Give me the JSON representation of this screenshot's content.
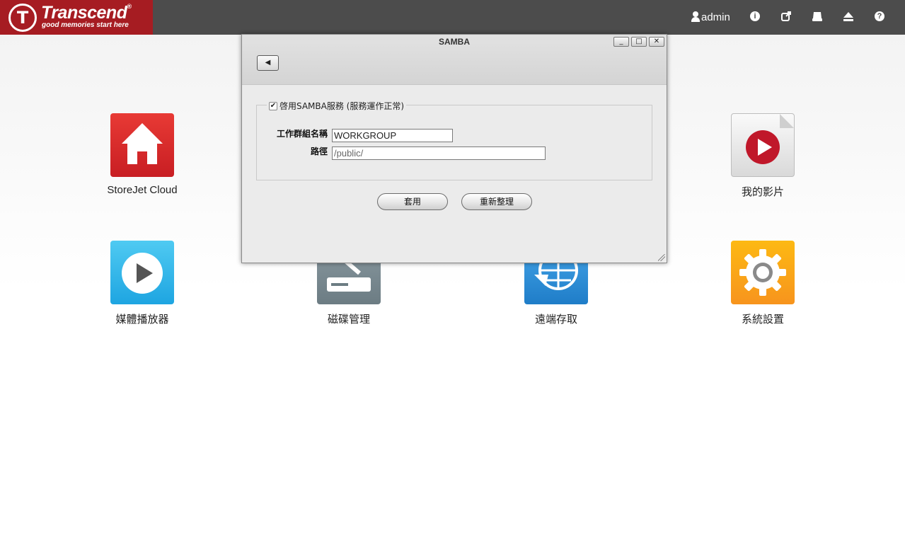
{
  "brand": {
    "name": "Transcend",
    "registered": "®",
    "tagline": "good memories start here",
    "mark_letter": "T",
    "color": "#a61c22"
  },
  "topbar": {
    "user": "admin",
    "icons": [
      "user-icon",
      "info-icon",
      "external-link-icon",
      "drive-icon",
      "eject-icon",
      "help-icon"
    ],
    "background": "#4c4c4c"
  },
  "apps": [
    {
      "label": "StoreJet Cloud",
      "icon": "home-icon",
      "color": "#d9282a"
    },
    {
      "label": "我的影片",
      "icon": "video-play-icon",
      "color": "#e8e8e8"
    },
    {
      "label": "媒體播放器",
      "icon": "play-icon",
      "color": "#29b3e6"
    },
    {
      "label": "磁碟管理",
      "icon": "disk-icon",
      "color": "#7a8b93"
    },
    {
      "label": "遠端存取",
      "icon": "globe-icon",
      "color": "#2f8fd8"
    },
    {
      "label": "系統設置",
      "icon": "gear-icon",
      "color": "#f7941d"
    }
  ],
  "dialog": {
    "title": "SAMBA",
    "enable_label": "啓用SAMBA服務 (服務運作正常)",
    "enabled": true,
    "workgroup_label": "工作群組名稱",
    "workgroup_value": "WORKGROUP",
    "path_label": "路徑",
    "path_value": "/public/",
    "apply_label": "套用",
    "refresh_label": "重新整理"
  }
}
